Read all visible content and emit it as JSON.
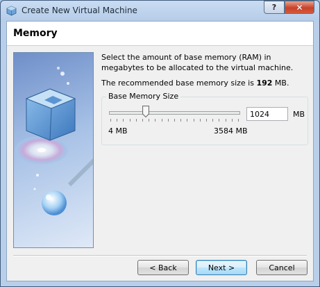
{
  "window": {
    "title": "Create New Virtual Machine",
    "help_label": "?",
    "close_label": "✕"
  },
  "page": {
    "title": "Memory",
    "description": "Select the amount of base memory (RAM) in megabytes to be allocated to the virtual machine.",
    "recommend_prefix": "The recommended base memory size is ",
    "recommend_value": "192",
    "recommend_suffix": " MB."
  },
  "memory": {
    "group_label": "Base Memory Size",
    "value": "1024",
    "unit": "MB",
    "min_label": "4 MB",
    "max_label": "3584 MB",
    "slider_fraction": 0.284
  },
  "buttons": {
    "back": "< Back",
    "next": "Next >",
    "cancel": "Cancel"
  },
  "colors": {
    "title_bar": "#b9cfe9",
    "client_bg": "#f0f0f0",
    "close_red": "#c8412a"
  }
}
